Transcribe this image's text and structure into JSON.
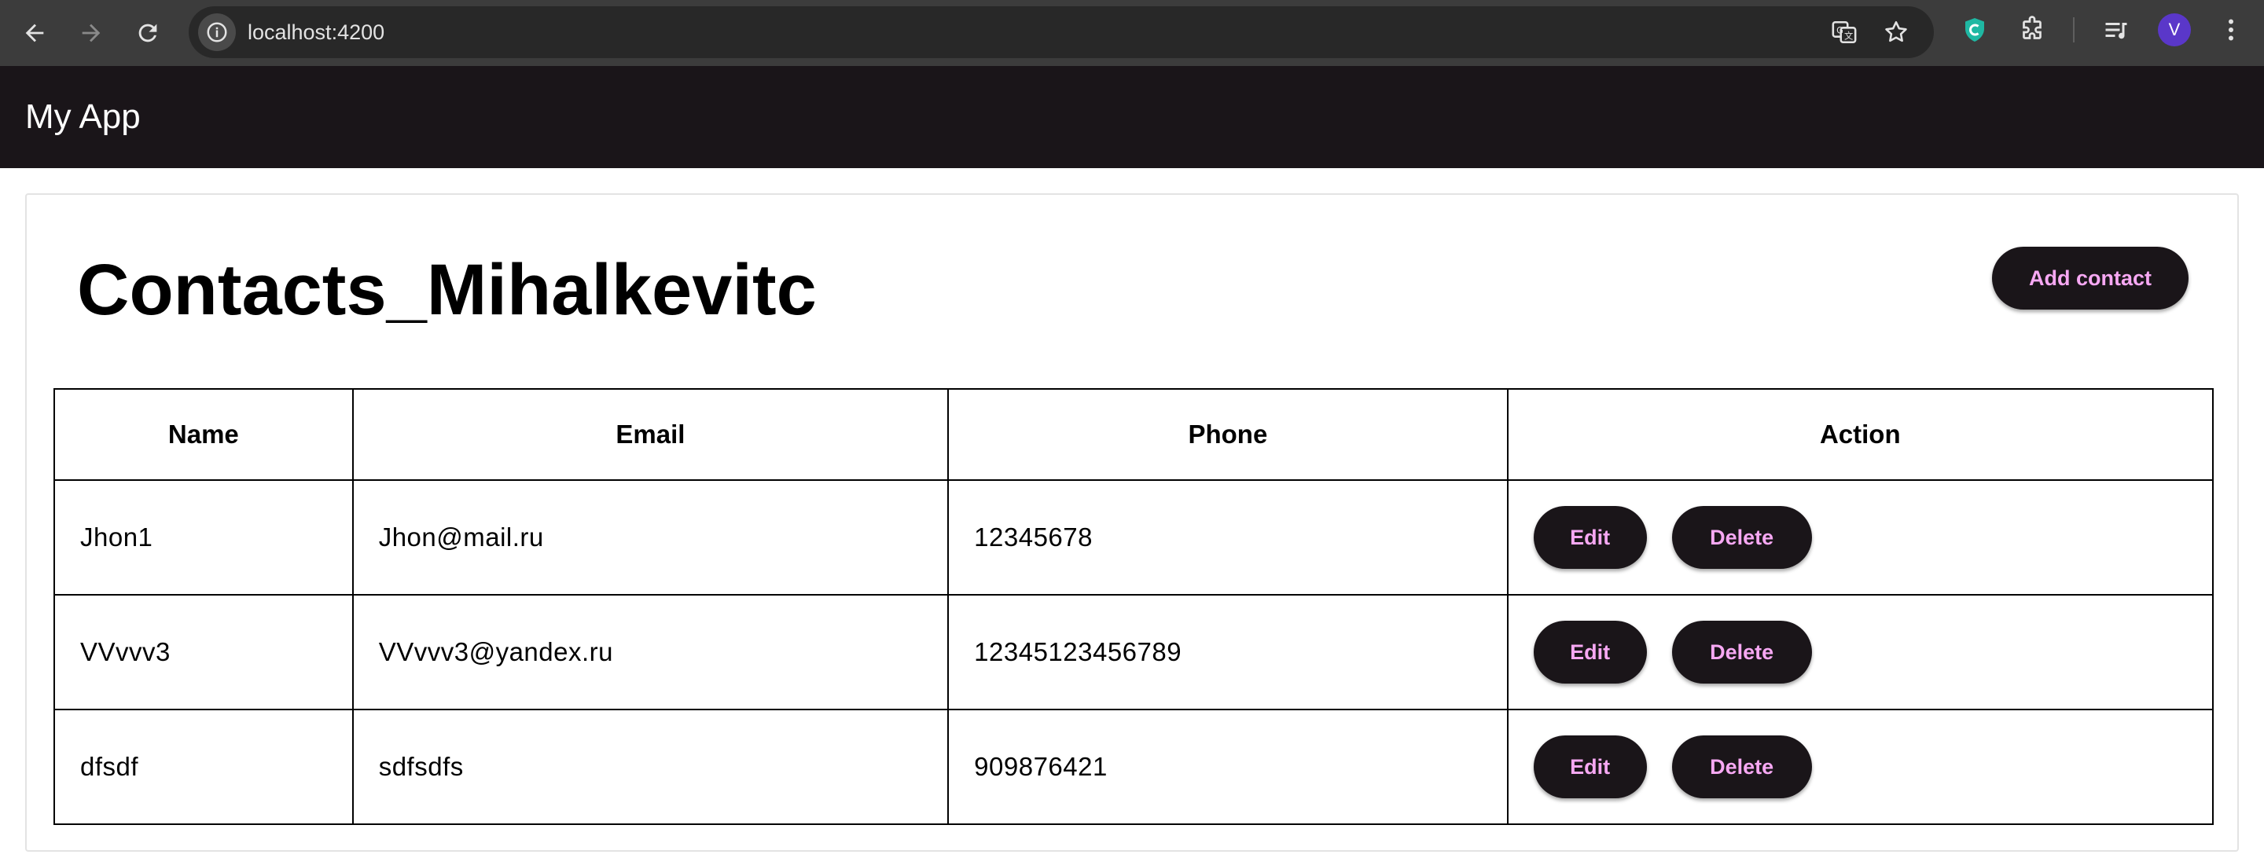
{
  "browser": {
    "url": "localhost:4200",
    "profile_initial": "V",
    "icons": {
      "back": "back-arrow-icon",
      "forward": "forward-arrow-icon",
      "reload": "reload-icon",
      "site_info": "info-icon",
      "translate": "translate-icon",
      "bookmark": "star-icon",
      "extension_shield": "shield-extension-icon",
      "extensions": "puzzle-icon",
      "media": "media-queue-icon",
      "menu": "kebab-menu-icon"
    }
  },
  "app": {
    "title": "My App"
  },
  "page": {
    "title": "Contacts_Mihalkevitc",
    "add_button": "Add contact"
  },
  "table": {
    "headers": [
      "Name",
      "Email",
      "Phone",
      "Action"
    ],
    "rows": [
      {
        "name": "Jhon1",
        "email": "Jhon@mail.ru",
        "phone": "12345678",
        "edit": "Edit",
        "delete": "Delete"
      },
      {
        "name": "VVvvv3",
        "email": "VVvvv3@yandex.ru",
        "phone": "12345123456789",
        "edit": "Edit",
        "delete": "Delete"
      },
      {
        "name": "dfsdf",
        "email": "sdfsdfs",
        "phone": "909876421",
        "edit": "Edit",
        "delete": "Delete"
      }
    ]
  },
  "colors": {
    "toolbar_bg": "#1a1519",
    "button_bg": "#1a1519",
    "button_text": "#f7a8f3",
    "chrome_bg": "#3c3c3c"
  }
}
